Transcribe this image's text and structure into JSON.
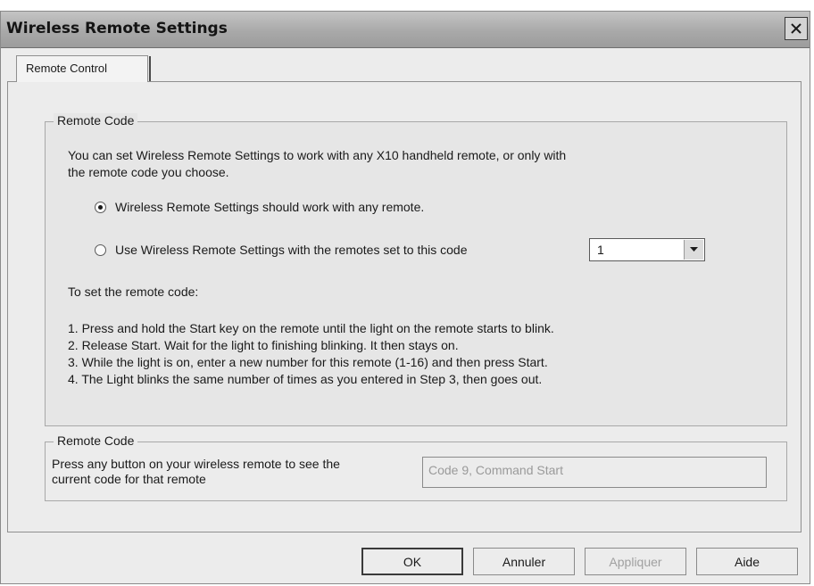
{
  "window": {
    "title": "Wireless Remote Settings"
  },
  "tabs": [
    {
      "label": "Remote Control"
    }
  ],
  "remote_code_group": {
    "legend": "Remote Code",
    "description_line1": "You can set Wireless Remote Settings to work with any X10 handheld remote, or only with",
    "description_line2": "the remote code you choose.",
    "options": [
      {
        "label": "Wireless Remote Settings should work with any remote.",
        "checked": true
      },
      {
        "label": "Use Wireless Remote Settings with the remotes set to this code",
        "checked": false
      }
    ],
    "code_select_value": "1",
    "instructions_heading": "To set the remote code:",
    "steps": [
      "1. Press and hold the Start key on the remote until the light on the remote starts to blink.",
      "2. Release Start. Wait for the light to finishing blinking. It then stays on.",
      "3. While the light is on, enter a new number for this remote (1-16) and then press Start.",
      "4. The Light blinks the same number of times as you entered in Step 3, then goes out."
    ]
  },
  "current_code_group": {
    "legend": "Remote Code",
    "description_line1": "Press any button on your wireless remote to see the",
    "description_line2": "current code for that remote",
    "field_value": "Code 9, Command Start"
  },
  "buttons": {
    "ok": "OK",
    "cancel": "Annuler",
    "apply": "Appliquer",
    "help": "Aide"
  }
}
